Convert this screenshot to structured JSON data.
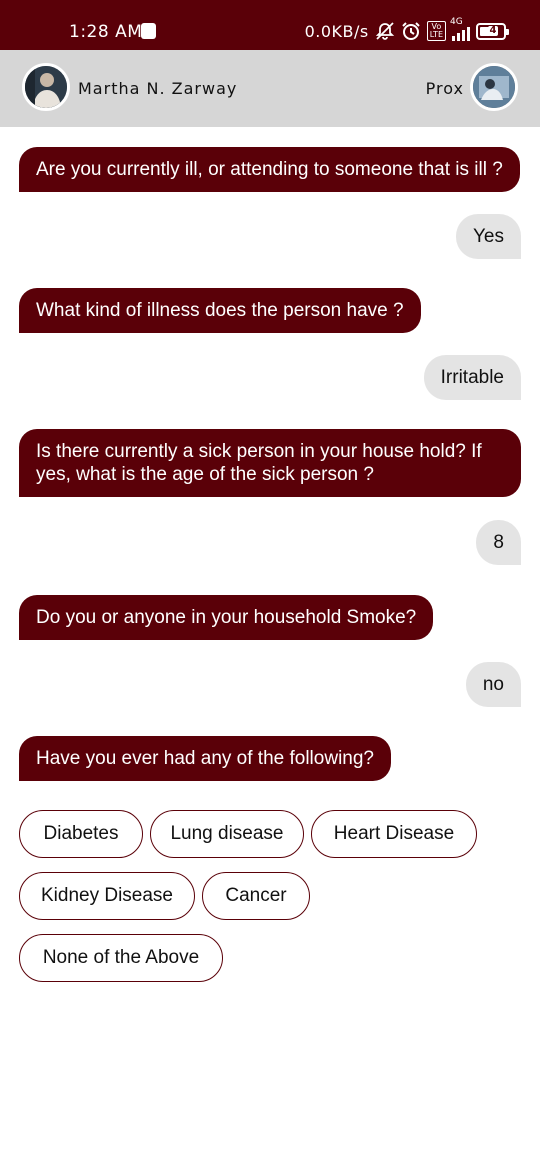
{
  "status_bar": {
    "time": "1:28 AM",
    "net_speed": "0.0KB/s",
    "network_type": "4G",
    "volte_top": "Vo",
    "volte_bottom": "LTE",
    "battery": "4"
  },
  "header": {
    "left_name": "Martha N. Zarway",
    "right_name": "Prox"
  },
  "colors": {
    "accent": "#5a0008",
    "answer_bubble": "#e4e4e4",
    "header_bg": "#d6d6d6"
  },
  "messages": [
    {
      "from": "bot",
      "text": "Are you currently ill, or attending to someone that is ill ?"
    },
    {
      "from": "user",
      "text": "Yes"
    },
    {
      "from": "bot",
      "text": "What kind of illness does the person have ?"
    },
    {
      "from": "user",
      "text": "Irritable"
    },
    {
      "from": "bot",
      "text": "Is there currently a sick person in your house hold? If yes, what is the age of the sick person ?"
    },
    {
      "from": "user",
      "text": "8"
    },
    {
      "from": "bot",
      "text": "Do you or anyone in your household Smoke?"
    },
    {
      "from": "user",
      "text": "no"
    },
    {
      "from": "bot",
      "text": "Have you ever had any of the following?"
    }
  ],
  "options": [
    "Diabetes",
    "Lung disease",
    "Heart Disease",
    "Kidney Disease",
    "Cancer",
    "None of the Above"
  ]
}
